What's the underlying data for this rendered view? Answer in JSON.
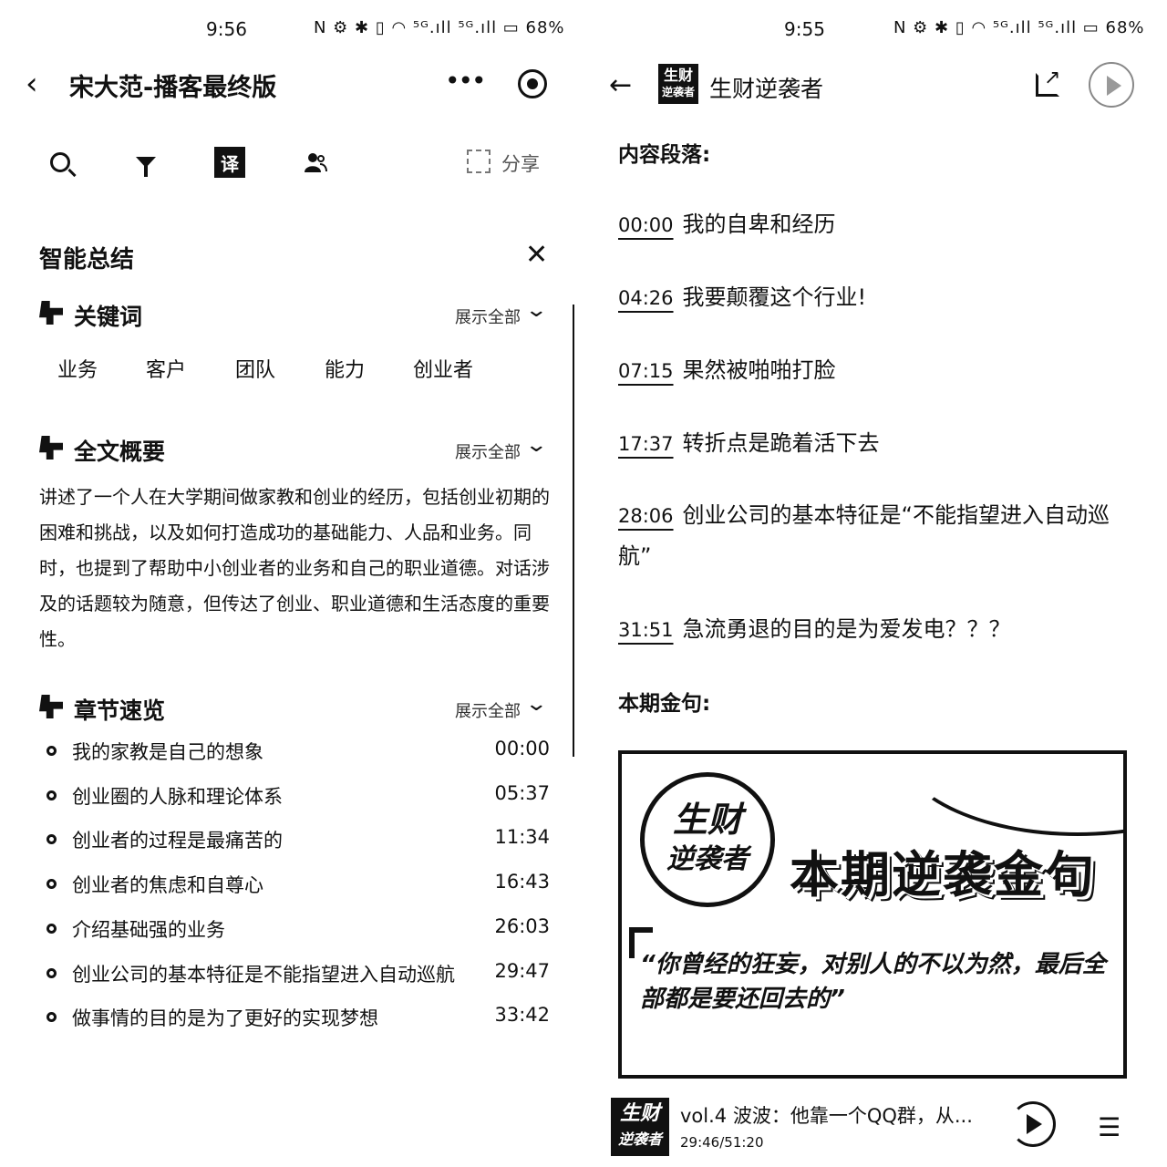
{
  "left": {
    "status": {
      "time": "9:56",
      "icons": "N ⚙ ✱ ▯ ◠ ⁵ᴳ.ıll ⁵ᴳ.ıll ▭",
      "battery": "68%"
    },
    "header": {
      "back_icon": "chevron-left",
      "title": "宋大范-播客最终版",
      "more_icon": "more-dots",
      "record_icon": "record"
    },
    "toolbar": {
      "search_icon": "search",
      "filter_icon": "filter",
      "translate_label": "译",
      "people_icon": "people",
      "share_label": "分享"
    },
    "summary": {
      "title": "智能总结",
      "close_label": "✕",
      "keywords": {
        "title": "关键词",
        "expand_label": "展示全部",
        "items": [
          "业务",
          "客户",
          "团队",
          "能力",
          "创业者"
        ]
      },
      "overview": {
        "title": "全文概要",
        "expand_label": "展示全部",
        "text": "讲述了一个人在大学期间做家教和创业的经历，包括创业初期的困难和挑战，以及如何打造成功的基础能力、人品和业务。同时，也提到了帮助中小创业者的业务和自己的职业道德。对话涉及的话题较为随意，但传达了创业、职业道德和生活态度的重要性。"
      },
      "chapters": {
        "title": "章节速览",
        "expand_label": "展示全部",
        "items": [
          {
            "title": "我的家教是自己的想象",
            "time": "00:00"
          },
          {
            "title": "创业圈的人脉和理论体系",
            "time": "05:37"
          },
          {
            "title": "创业者的过程是最痛苦的",
            "time": "11:34"
          },
          {
            "title": "创业者的焦虑和自尊心",
            "time": "16:43"
          },
          {
            "title": "介绍基础强的业务",
            "time": "26:03"
          },
          {
            "title": "创业公司的基本特征是不能指望进入自动巡航",
            "time": "29:47"
          },
          {
            "title": "做事情的目的是为了更好的实现梦想",
            "time": "33:42"
          }
        ]
      }
    }
  },
  "right": {
    "status": {
      "time": "9:55",
      "icons": "N ⚙ ✱ ▯ ◠ ⁵ᴳ.ıll ⁵ᴳ.ıll ▭",
      "battery": "68%"
    },
    "header": {
      "back_label": "←",
      "logo_text_1": "生财",
      "logo_text_2": "逆袭者",
      "title": "生财逆袭者",
      "share_icon": "external-link",
      "play_icon": "play-circle"
    },
    "segments_title": "内容段落:",
    "segments": [
      {
        "ts": "00:00",
        "text": "我的自卑和经历"
      },
      {
        "ts": "04:26",
        "text": "我要颠覆这个行业!"
      },
      {
        "ts": "07:15",
        "text": "果然被啪啪打脸"
      },
      {
        "ts": "17:37",
        "text": "转折点是跪着活下去"
      },
      {
        "ts": "28:06",
        "text": "创业公司的基本特征是“不能指望进入自动巡航”"
      },
      {
        "ts": "31:51",
        "text": "急流勇退的目的是为爱发电？？？"
      }
    ],
    "gold_title": "本期金句:",
    "quote_card": {
      "logo_line_1": "生财",
      "logo_line_2": "逆袭者",
      "title": "本期逆袭金句",
      "quote": "“你曾经的狂妄，对别人的不以为然，最后全部都是要还回去的”"
    },
    "mini_player": {
      "cover_line_1": "生财",
      "cover_line_2": "逆袭者",
      "title": "vol.4 波波：他靠一个QQ群，从...",
      "time": "29:46/51:20",
      "play_icon": "play",
      "playlist_label": "☰"
    }
  }
}
